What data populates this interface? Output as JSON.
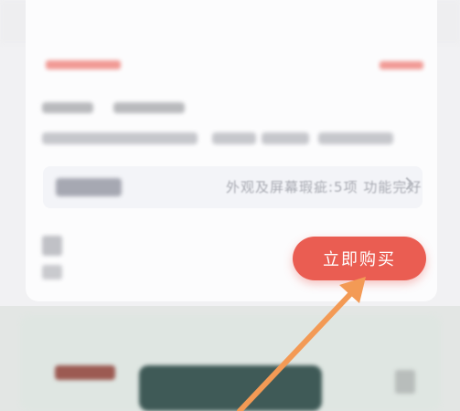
{
  "product": {
    "condition_summary": "外观及屏幕瑕疵:5项 功能完好",
    "buy_button_label": "立即购买"
  },
  "colors": {
    "accent": "#ea5d52",
    "arrow": "#f39a55"
  },
  "icons": {
    "condition_chevron": "chevron-right-icon",
    "annotation": "annotation-arrow-icon"
  }
}
